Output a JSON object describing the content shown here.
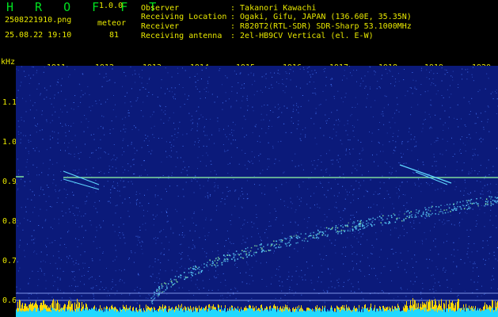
{
  "header": {
    "app_name": "H R O F F T",
    "version": "1.0.0",
    "filename": "2508221910.png",
    "category": "meteor",
    "datetime": "25.08.22 19:10",
    "count": "81",
    "info": [
      {
        "key": "Observer",
        "value": ": Takanori Kawachi"
      },
      {
        "key": "Receiving Location",
        "value": ": Ogaki, Gifu, JAPAN (136.60E, 35.35N)"
      },
      {
        "key": "Receiver",
        "value": ": R820T2(RTL-SDR) SDR-Sharp 53.1000MHz"
      },
      {
        "key": "Receiving antenna",
        "value": ": 2el-HB9CV Vertical (el. E-W)"
      }
    ]
  },
  "spectrogram": {
    "y_unit": "kHz",
    "x_ticks": [
      "1911",
      "1912",
      "1913",
      "1914",
      "1915",
      "1916",
      "1917",
      "1918",
      "1919",
      "1920"
    ],
    "y_ticks": [
      "1.1",
      "1.0",
      "0.9",
      "0.8",
      "0.7",
      "0.6"
    ],
    "colors": {
      "background": "#0b1a7a",
      "noise": "#4a7cff",
      "carrier": "#8cf0a0",
      "trail": "#5fd6ff",
      "baseline": "#20d8ff",
      "peaks": "#ffd800",
      "text": "#e8e800",
      "logo": "#00e020"
    }
  }
}
